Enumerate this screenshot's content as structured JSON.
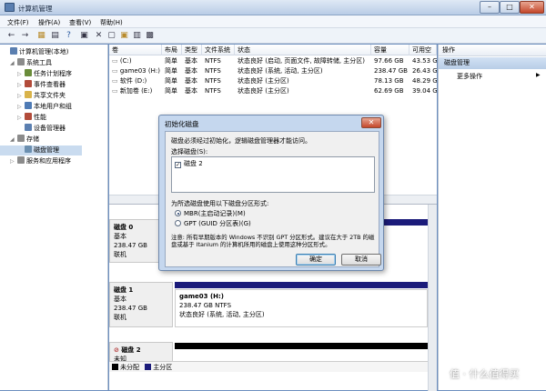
{
  "window": {
    "title": "计算机管理",
    "min": "–",
    "max": "□",
    "close": "✕"
  },
  "menu": [
    "文件(F)",
    "操作(A)",
    "查看(V)",
    "帮助(H)"
  ],
  "toolbar": [
    "←",
    "→",
    "▦",
    "▤",
    "?",
    "▣",
    "✕",
    "▢",
    "▣",
    "▥",
    "▩"
  ],
  "tree": [
    {
      "label": "计算机管理(本地)",
      "level": 0,
      "arrow": "",
      "icon": "computer-icon",
      "color": "#5b7fb0"
    },
    {
      "label": "系统工具",
      "level": 1,
      "arrow": "◢",
      "icon": "tools-icon",
      "color": "#8b8b8b"
    },
    {
      "label": "任务计划程序",
      "level": 2,
      "arrow": "▷",
      "icon": "clock-icon",
      "color": "#6a8c3a"
    },
    {
      "label": "事件查看器",
      "level": 2,
      "arrow": "▷",
      "icon": "event-icon",
      "color": "#b24b3a"
    },
    {
      "label": "共享文件夹",
      "level": 2,
      "arrow": "▷",
      "icon": "folder-icon",
      "color": "#d9b34a"
    },
    {
      "label": "本地用户和组",
      "level": 2,
      "arrow": "▷",
      "icon": "users-icon",
      "color": "#4f7bb5"
    },
    {
      "label": "性能",
      "level": 2,
      "arrow": "▷",
      "icon": "performance-icon",
      "color": "#b24b3a"
    },
    {
      "label": "设备管理器",
      "level": 2,
      "arrow": "",
      "icon": "device-icon",
      "color": "#5b7fb0"
    },
    {
      "label": "存储",
      "level": 1,
      "arrow": "◢",
      "icon": "storage-icon",
      "color": "#8b8b8b"
    },
    {
      "label": "磁盘管理",
      "level": 2,
      "arrow": "",
      "icon": "disk-icon",
      "color": "#6b8fb0",
      "selected": true
    },
    {
      "label": "服务和应用程序",
      "level": 1,
      "arrow": "▷",
      "icon": "services-icon",
      "color": "#8b8b8b"
    }
  ],
  "columns": [
    "卷",
    "布局",
    "类型",
    "文件系统",
    "状态",
    "容量",
    "可用空"
  ],
  "volumes": [
    {
      "vol": "(C:)",
      "layout": "简单",
      "type": "基本",
      "fs": "NTFS",
      "status": "状态良好 (启动, 页面文件, 故障转储, 主分区)",
      "cap": "97.66 GB",
      "free": "43.53 G"
    },
    {
      "vol": "game03 (H:)",
      "layout": "简单",
      "type": "基本",
      "fs": "NTFS",
      "status": "状态良好 (系统, 活动, 主分区)",
      "cap": "238.47 GB",
      "free": "26.43 G"
    },
    {
      "vol": "软件 (D:)",
      "layout": "简单",
      "type": "基本",
      "fs": "NTFS",
      "status": "状态良好 (主分区)",
      "cap": "78.13 GB",
      "free": "48.29 G"
    },
    {
      "vol": "新加卷 (E:)",
      "layout": "简单",
      "type": "基本",
      "fs": "NTFS",
      "status": "状态良好 (主分区)",
      "cap": "62.69 GB",
      "free": "39.04 G"
    }
  ],
  "actions": {
    "header": "操作",
    "selected": "磁盘管理",
    "more": "更多操作"
  },
  "disks": [
    {
      "name": "磁盘 0",
      "type": "基本",
      "size": "238.47 GB",
      "status": "联机"
    },
    {
      "name": "磁盘 1",
      "type": "基本",
      "size": "238.47 GB",
      "status": "联机",
      "part_name": "game03  (H:)",
      "part_size": "238.47 GB NTFS",
      "part_status": "状态良好 (系统, 活动, 主分区)"
    },
    {
      "name": "磁盘 2",
      "type": "未知",
      "size": "",
      "status": ""
    }
  ],
  "legend": {
    "unallocated": "未分配",
    "primary": "主分区"
  },
  "dialog": {
    "title": "初始化磁盘",
    "message": "磁盘必须经过初始化，逻辑磁盘管理器才能访问。",
    "select_label": "选择磁盘(S):",
    "disk_item": "磁盘 2",
    "style_label": "为所选磁盘使用以下磁盘分区形式:",
    "mbr": "MBR(主启动记录)(M)",
    "gpt": "GPT (GUID 分区表)(G)",
    "note": "注意: 所有早期版本的 Windows 不识别 GPT 分区形式。建议在大于 2TB 的磁盘或基于 Itanium 的计算机所用的磁盘上使用这种分区形式。",
    "ok": "确定",
    "cancel": "取消"
  },
  "watermark": "值 · 什么值得买",
  "colors": {
    "primary_partition": "#1b1b7a",
    "unallocated": "#000000",
    "selection": "#c9dbef"
  }
}
